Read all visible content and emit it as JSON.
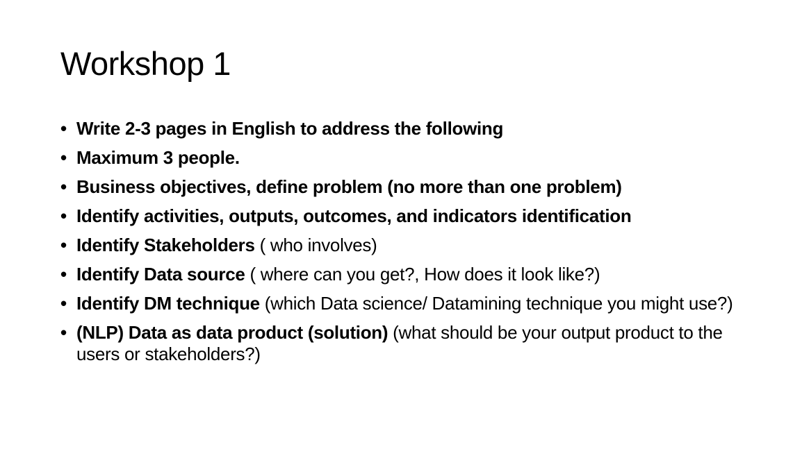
{
  "slide": {
    "title": "Workshop 1",
    "bullets": [
      {
        "bold": "Write 2-3 pages in English to address the following",
        "rest": ""
      },
      {
        "bold": "Maximum 3 people.",
        "rest": ""
      },
      {
        "bold": "Business objectives, define problem (no more than one problem)",
        "rest": ""
      },
      {
        "bold": "Identify activities, outputs, outcomes, and indicators identification",
        "rest": ""
      },
      {
        "bold": "Identify Stakeholders",
        "rest": " ( who involves)"
      },
      {
        "bold": "Identify Data source",
        "rest": " ( where can you get?, How does it look like?)"
      },
      {
        "bold": "Identify DM technique",
        "rest": " (which Data science/ Datamining technique you might use?)"
      },
      {
        "bold": "(NLP) Data as data product (solution)",
        "rest": " (what should be your output product to the users or stakeholders?)"
      }
    ],
    "bullet_glyph": "•"
  }
}
